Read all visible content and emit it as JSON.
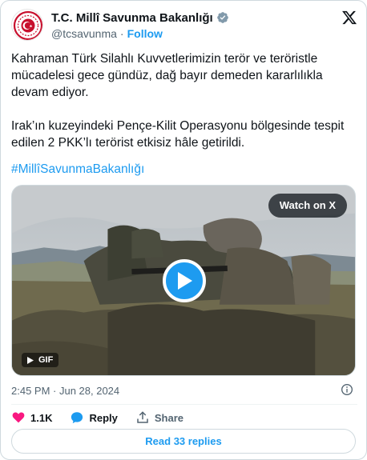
{
  "account": {
    "name": "T.C. Millî Savunma Bakanlığı",
    "handle": "@tcsavunma",
    "separator": "·",
    "follow_label": "Follow"
  },
  "tweet": {
    "paragraph1": "Kahraman Türk Silahlı Kuvvetlerimizin terör ve teröristle mücadelesi gece gündüz, dağ bayır demeden kararlılıkla devam ediyor.",
    "paragraph2": "Irak’ın kuzeyindeki Pençe-Kilit Operasyonu bölgesinde tespit edilen 2 PKK’lı terörist etkisiz hâle getirildi.",
    "hashtag": "#MillîSavunmaBakanlığı"
  },
  "media": {
    "watch_label": "Watch on X",
    "gif_label": "GIF"
  },
  "meta": {
    "timestamp": "2:45 PM · Jun 28, 2024"
  },
  "actions": {
    "like_count": "1.1K",
    "reply_label": "Reply",
    "share_label": "Share"
  },
  "read_replies_label": "Read 33 replies",
  "colors": {
    "accent": "#1d9bf0",
    "like": "#f91880",
    "text": "#0f1419",
    "muted": "#536471",
    "logo_red": "#c8102e"
  },
  "icons": [
    "ministry-logo-icon",
    "verified-badge-icon",
    "x-logo-icon",
    "play-icon",
    "gif-icon",
    "info-icon",
    "heart-icon",
    "reply-bubble-icon",
    "share-icon"
  ]
}
